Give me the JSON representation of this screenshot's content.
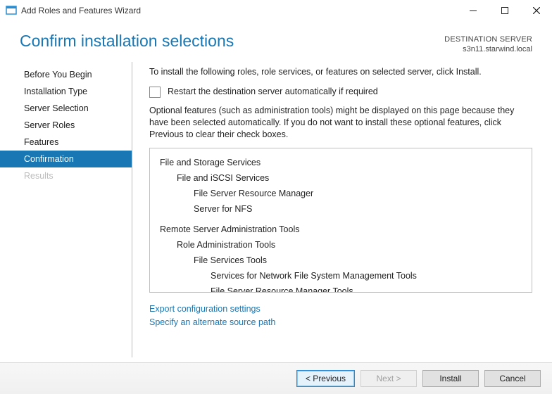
{
  "window": {
    "title": "Add Roles and Features Wizard"
  },
  "header": {
    "title": "Confirm installation selections",
    "destination_label": "DESTINATION SERVER",
    "destination_value": "s3n11.starwind.local"
  },
  "sidebar": {
    "items": [
      {
        "label": "Before You Begin",
        "active": false,
        "disabled": false
      },
      {
        "label": "Installation Type",
        "active": false,
        "disabled": false
      },
      {
        "label": "Server Selection",
        "active": false,
        "disabled": false
      },
      {
        "label": "Server Roles",
        "active": false,
        "disabled": false
      },
      {
        "label": "Features",
        "active": false,
        "disabled": false
      },
      {
        "label": "Confirmation",
        "active": true,
        "disabled": false
      },
      {
        "label": "Results",
        "active": false,
        "disabled": true
      }
    ]
  },
  "content": {
    "intro": "To install the following roles, role services, or features on selected server, click Install.",
    "restart_checkbox_label": "Restart the destination server automatically if required",
    "restart_checked": false,
    "optional_note": "Optional features (such as administration tools) might be displayed on this page because they have been selected automatically. If you do not want to install these optional features, click Previous to clear their check boxes.",
    "feature_tree": [
      {
        "label": "File and Storage Services",
        "level": 0
      },
      {
        "label": "File and iSCSI Services",
        "level": 1
      },
      {
        "label": "File Server Resource Manager",
        "level": 2
      },
      {
        "label": "Server for NFS",
        "level": 2
      },
      {
        "label": "Remote Server Administration Tools",
        "level": 0
      },
      {
        "label": "Role Administration Tools",
        "level": 1
      },
      {
        "label": "File Services Tools",
        "level": 2
      },
      {
        "label": "Services for Network File System Management Tools",
        "level": 3
      },
      {
        "label": "File Server Resource Manager Tools",
        "level": 3
      }
    ],
    "links": {
      "export": "Export configuration settings",
      "alternate_source": "Specify an alternate source path"
    }
  },
  "footer": {
    "previous": "< Previous",
    "next": "Next >",
    "install": "Install",
    "cancel": "Cancel"
  }
}
